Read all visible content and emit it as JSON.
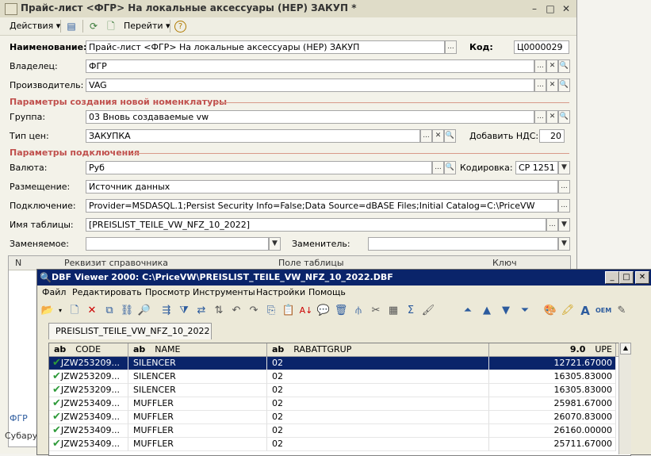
{
  "form": {
    "title": "Прайс-лист <ФГР> На локальные аксессуары (НЕР) ЗАКУП *",
    "toolbar": {
      "actions": "Действия",
      "goto": "Перейти"
    },
    "fields": {
      "name_label": "Наименование:",
      "name_value": "Прайс-лист <ФГР> На локальные аксессуары (НЕР) ЗАКУП",
      "code_label": "Код:",
      "code_value": "Ц0000029",
      "owner_label": "Владелец:",
      "owner_value": "ФГР",
      "manufacturer_label": "Производитель:",
      "manufacturer_value": "VAG",
      "section_new": "Параметры создания новой номенклатуры",
      "group_label": "Группа:",
      "group_value": "03 Вновь создаваемые vw",
      "price_type_label": "Тип цен:",
      "price_type_value": "ЗАКУПКА",
      "vat_label": "Добавить НДС:",
      "vat_value": "20",
      "section_conn": "Параметры подключения",
      "currency_label": "Валюта:",
      "currency_value": "Руб",
      "encoding_label": "Кодировка:",
      "encoding_value": "CP 1251",
      "placement_label": "Размещение:",
      "placement_value": "Источник данных",
      "connection_label": "Подключение:",
      "connection_value": "Provider=MSDASQL.1;Persist Security Info=False;Data Source=dBASE Files;Initial Catalog=C:\\PriceVW",
      "table_label": "Имя таблицы:",
      "table_value": "[PREISLIST_TEILE_VW_NFZ_10_2022]",
      "replaced_label": "Заменяемое:",
      "replacer_label": "Заменитель:"
    },
    "grid": {
      "col_n": "N",
      "col_attr": "Реквизит справочника",
      "col_field": "Поле таблицы",
      "col_key": "Ключ"
    },
    "bottom_tab": "ФГР",
    "bottom_text": "Субару"
  },
  "dbf": {
    "title": "DBF Viewer 2000: C:\\PriceVW\\PREISLIST_TEILE_VW_NFZ_10_2022.DBF",
    "menu": [
      "Файл",
      "Редактировать",
      "Просмотр",
      "Инструменты",
      "Настройки",
      "Помощь"
    ],
    "tab": "PREISLIST_TEILE_VW_NFZ_10_2022",
    "type_tag": "ab",
    "upe_type": "9.0",
    "columns": [
      "CODE",
      "NAME",
      "RABATTGRUP",
      "UPE"
    ],
    "rows": [
      [
        "JZW253209...",
        "SILENCER",
        "02",
        "12721.67000"
      ],
      [
        "JZW253209...",
        "SILENCER",
        "02",
        "16305.83000"
      ],
      [
        "JZW253209...",
        "SILENCER",
        "02",
        "16305.83000"
      ],
      [
        "JZW253409...",
        "MUFFLER",
        "02",
        "25981.67000"
      ],
      [
        "JZW253409...",
        "MUFFLER",
        "02",
        "26070.83000"
      ],
      [
        "JZW253409...",
        "MUFFLER",
        "02",
        "26160.00000"
      ],
      [
        "JZW253409...",
        "MUFFLER",
        "02",
        "25711.67000"
      ]
    ]
  }
}
